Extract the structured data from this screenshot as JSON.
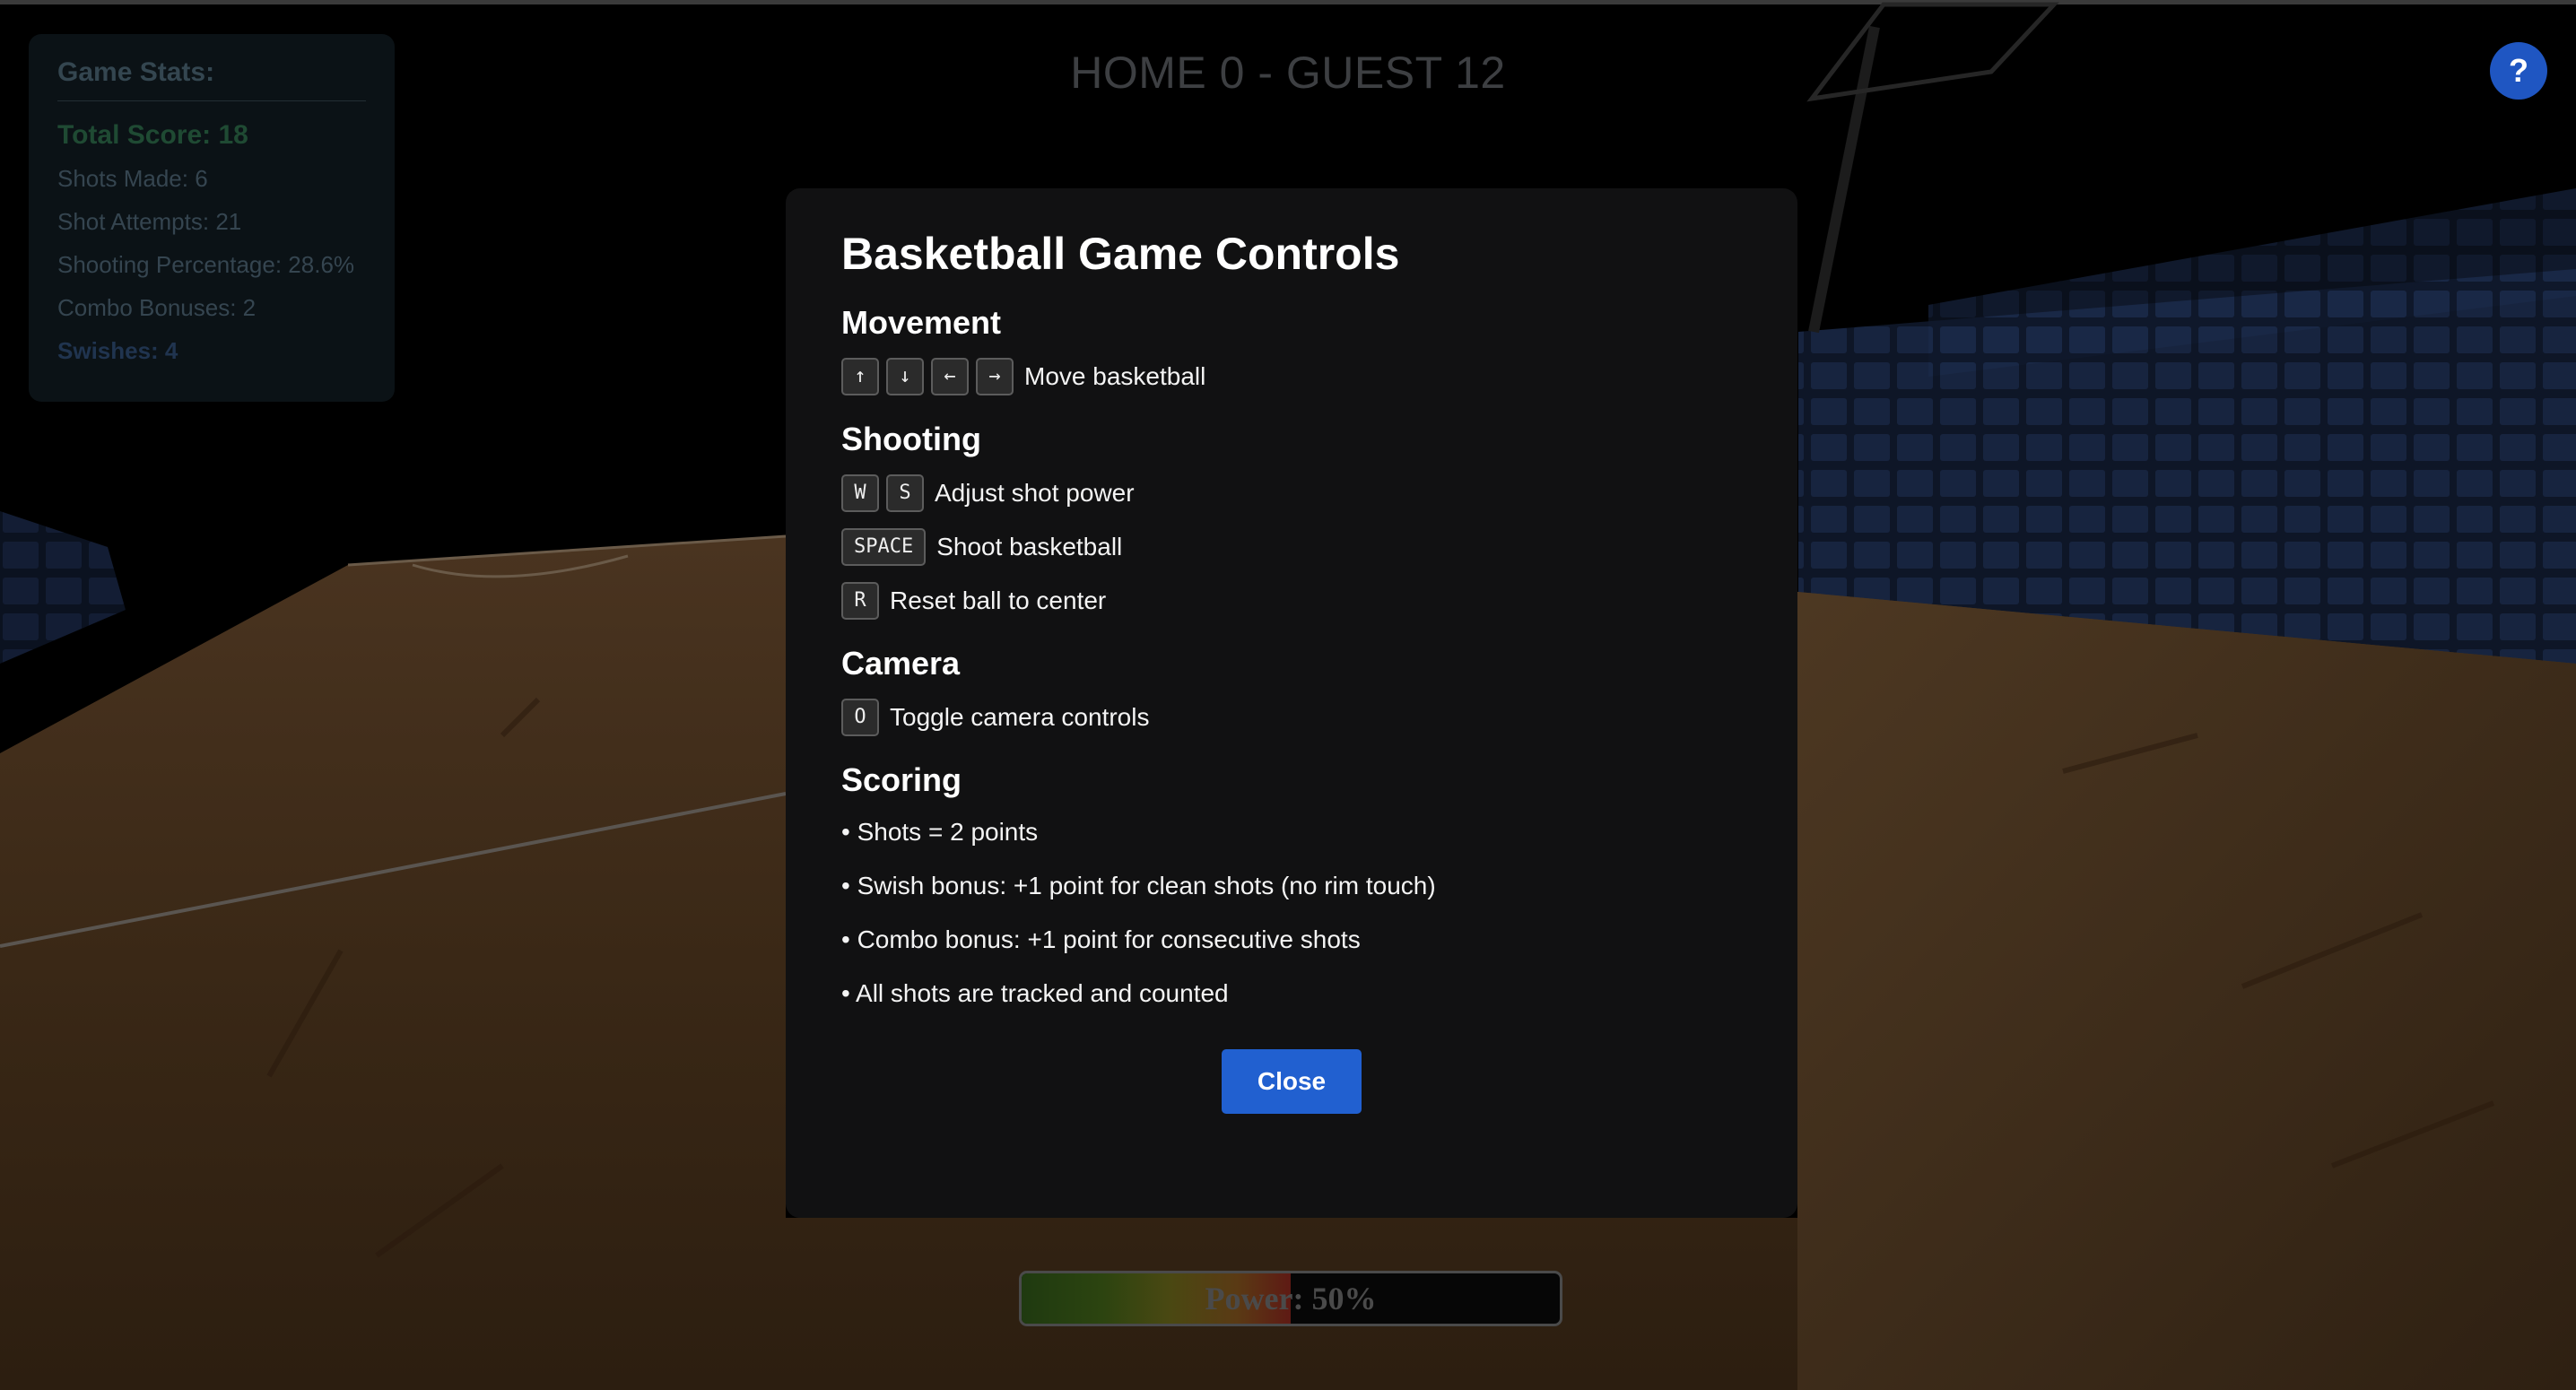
{
  "stats": {
    "title": "Game Stats:",
    "total_score": "Total Score: 18",
    "shots_made": "Shots Made: 6",
    "shot_attempts": "Shot Attempts: 21",
    "shooting_percentage": "Shooting Percentage: 28.6%",
    "combo_bonuses": "Combo Bonuses: 2",
    "swishes": "Swishes: 4"
  },
  "scoreboard": {
    "text": "HOME 0 - GUEST 12"
  },
  "help_button": {
    "label": "?"
  },
  "power": {
    "label": "Power: 50%",
    "fraction": 0.5
  },
  "modal": {
    "title": "Basketball Game Controls",
    "movement": {
      "heading": "Movement",
      "keys": [
        "↑",
        "↓",
        "←",
        "→"
      ],
      "desc": "Move basketball"
    },
    "shooting": {
      "heading": "Shooting",
      "power_keys": [
        "W",
        "S"
      ],
      "power_desc": "Adjust shot power",
      "shoot_key": "SPACE",
      "shoot_desc": "Shoot basketball",
      "reset_key": "R",
      "reset_desc": "Reset ball to center"
    },
    "camera": {
      "heading": "Camera",
      "key": "O",
      "desc": "Toggle camera controls"
    },
    "scoring": {
      "heading": "Scoring",
      "bullets": [
        "• Shots = 2 points",
        "• Swish bonus: +1 point for clean shots (no rim touch)",
        "• Combo bonus: +1 point for consecutive shots",
        "• All shots are tracked and counted"
      ]
    },
    "close_label": "Close"
  },
  "colors": {
    "accent": "#2160d0",
    "modal_bg": "#111112",
    "floor": "#3d2a17",
    "seats": "#1a2742"
  }
}
